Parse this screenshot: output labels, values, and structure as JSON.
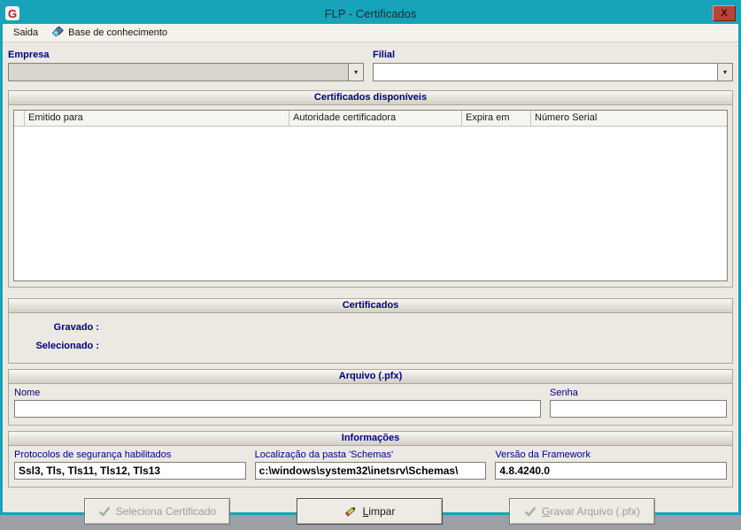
{
  "window": {
    "title": "FLP - Certificados",
    "close_label": "X",
    "logo_letter": "G"
  },
  "menu": {
    "items": [
      {
        "label": "Saida"
      },
      {
        "label": "Base de conhecimento"
      }
    ]
  },
  "form": {
    "empresa_label": "Empresa",
    "empresa_value": "",
    "filial_label": "Filial",
    "filial_value": ""
  },
  "sections": {
    "available": "Certificados disponíveis",
    "certificados": "Certificados",
    "arquivo": "Arquivo (.pfx)",
    "informacoes": "Informações"
  },
  "table": {
    "columns": [
      "Emitido para",
      "Autoridade certificadora",
      "Expira em",
      "Número Serial"
    ]
  },
  "certificados": {
    "gravado_label": "Gravado :",
    "selecionado_label": "Selecionado :"
  },
  "arquivo": {
    "nome_label": "Nome",
    "nome_value": "",
    "senha_label": "Senha",
    "senha_value": ""
  },
  "informacoes": {
    "protocolos_label": "Protocolos de segurança habilitados",
    "protocolos_value": "Ssl3, Tls, Tls11, Tls12, Tls13",
    "schemas_label": "Localização da pasta 'Schemas'",
    "schemas_value": "c:\\windows\\system32\\inetsrv\\Schemas\\",
    "framework_label": "Versão da Framework",
    "framework_value": "4.8.4240.0"
  },
  "buttons": {
    "seleciona_label": "Seleciona Certificado",
    "limpar_key": "L",
    "limpar_rest": "impar",
    "gravar_key": "G",
    "gravar_rest": "ravar Arquivo (.pfx)"
  },
  "colors": {
    "titlebar": "#17a3b9",
    "close_button": "#bc4238",
    "label_navy": "#000080",
    "check_green": "#1f8c1f"
  }
}
